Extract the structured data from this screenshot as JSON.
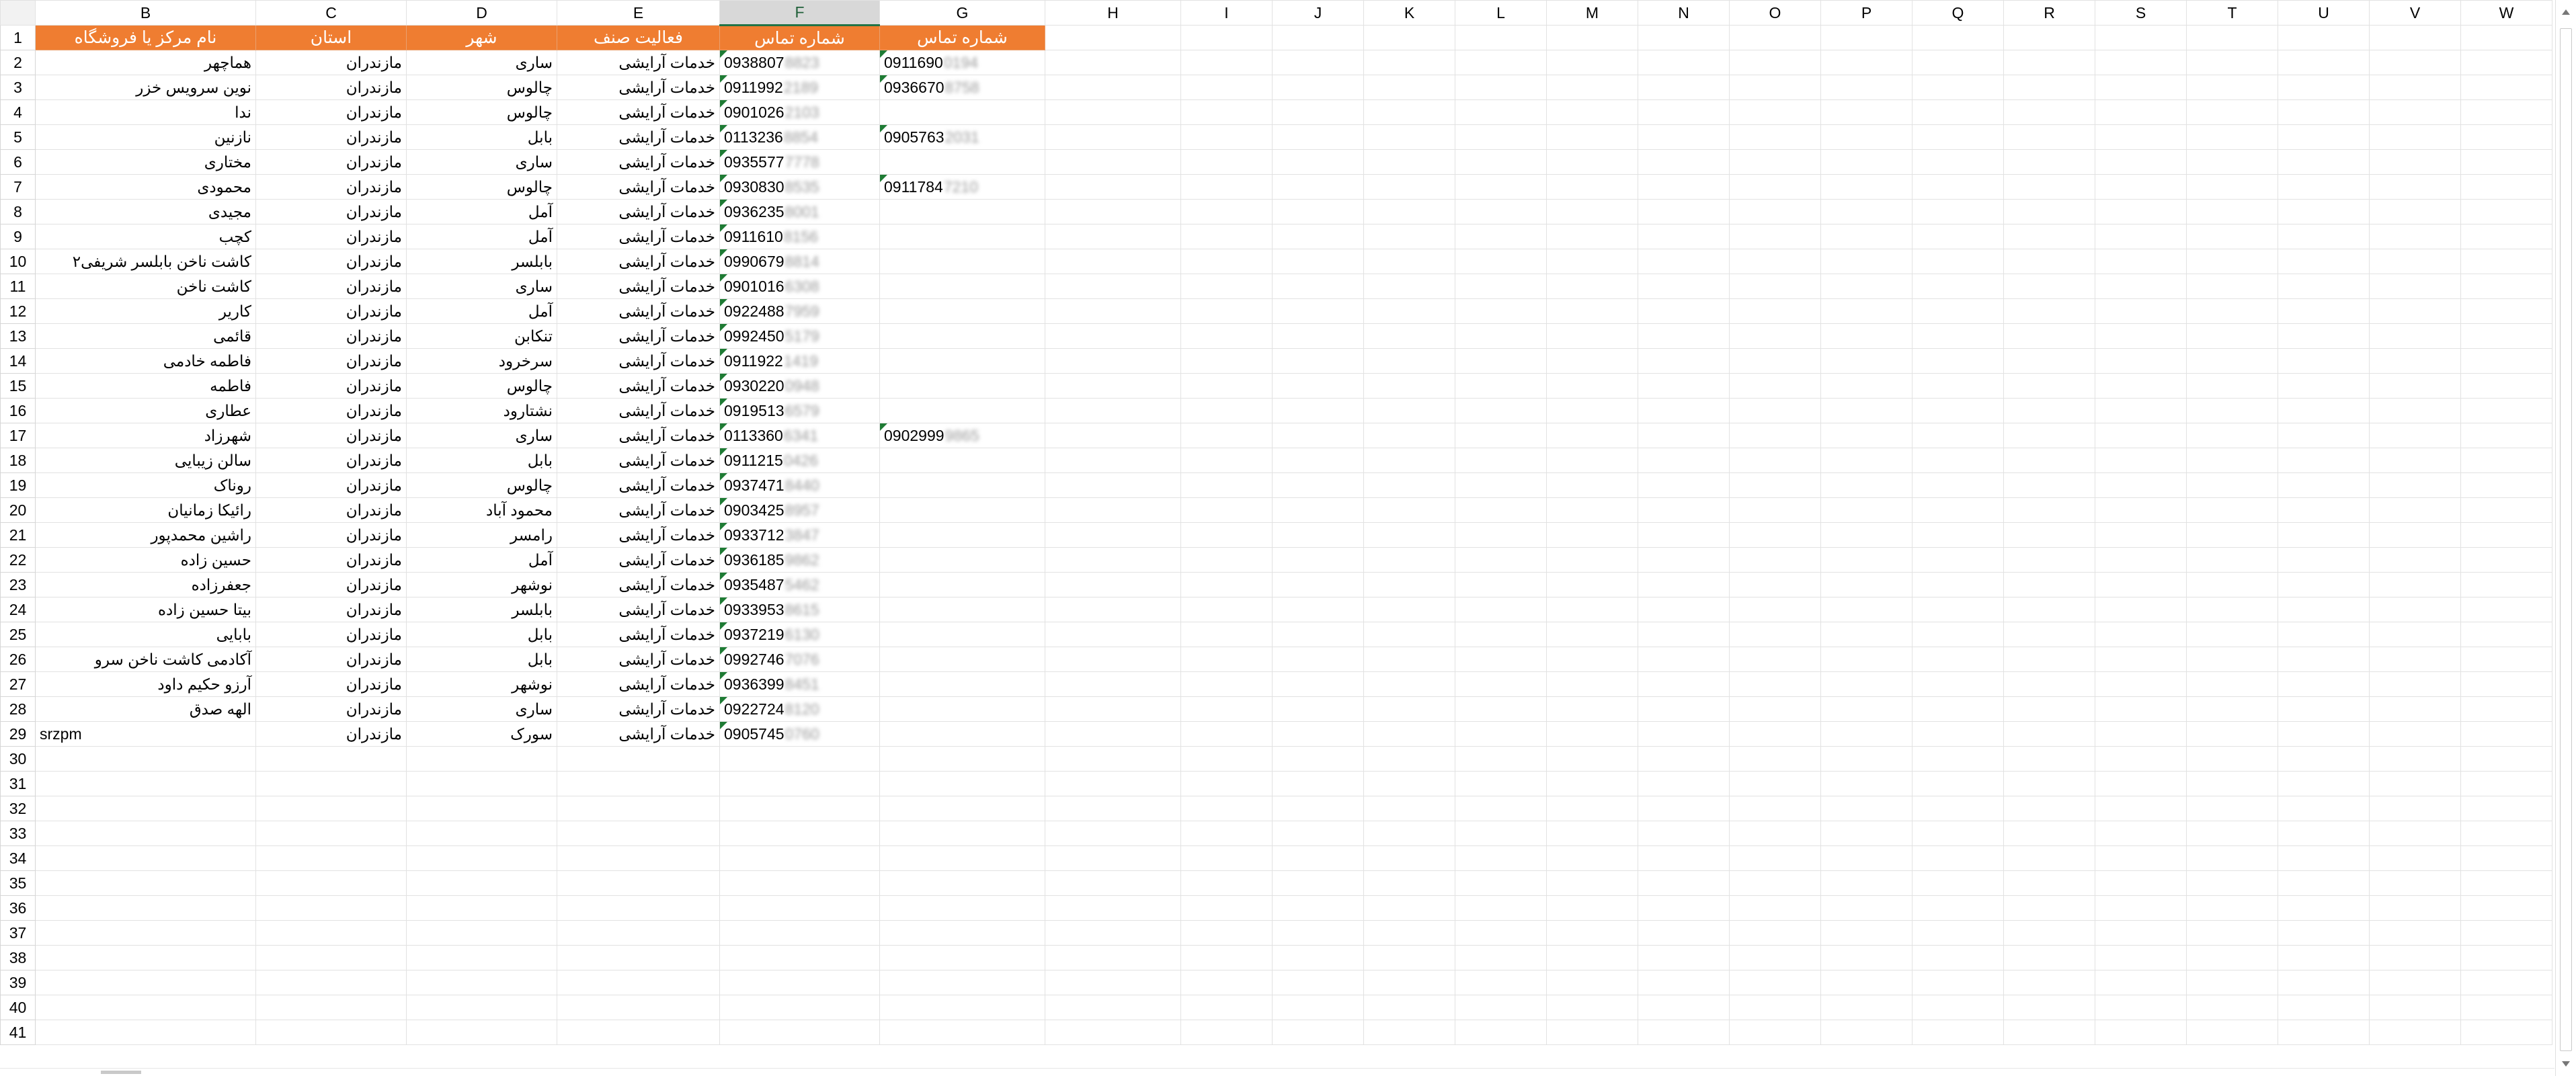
{
  "columns": [
    "B",
    "C",
    "D",
    "E",
    "F",
    "G",
    "H",
    "I",
    "J",
    "K",
    "L",
    "M",
    "N",
    "O",
    "P",
    "Q",
    "R",
    "S",
    "T",
    "U",
    "V",
    "W"
  ],
  "selected_column": "F",
  "header_row": {
    "B": "نام مرکز یا فروشگاه",
    "C": "استان",
    "D": "شهر",
    "E": "فعالیت صنف",
    "F": "شماره تماس",
    "G": "شماره تماس"
  },
  "rows": [
    {
      "n": "2",
      "name": "هماچهر",
      "province": "مازندران",
      "city": "ساری",
      "activity": "خدمات آرایشی",
      "phone1": "0938807",
      "phone1_hidden": "8823",
      "phone2": "0911690",
      "phone2_hidden": "0194"
    },
    {
      "n": "3",
      "name": "نوین سرویس خزر",
      "province": "مازندران",
      "city": "چالوس",
      "activity": "خدمات آرایشی",
      "phone1": "0911992",
      "phone1_hidden": "2189",
      "phone2": "0936670",
      "phone2_hidden": "8758"
    },
    {
      "n": "4",
      "name": "ندا",
      "province": "مازندران",
      "city": "چالوس",
      "activity": "خدمات آرایشی",
      "phone1": "0901026",
      "phone1_hidden": "2103",
      "phone2": "",
      "phone2_hidden": ""
    },
    {
      "n": "5",
      "name": "نازنین",
      "province": "مازندران",
      "city": "بابل",
      "activity": "خدمات آرایشی",
      "phone1": "0113236",
      "phone1_hidden": "8854",
      "phone2": "0905763",
      "phone2_hidden": "2031"
    },
    {
      "n": "6",
      "name": "مختاری",
      "province": "مازندران",
      "city": "ساری",
      "activity": "خدمات آرایشی",
      "phone1": "0935577",
      "phone1_hidden": "7778",
      "phone2": "",
      "phone2_hidden": ""
    },
    {
      "n": "7",
      "name": "محمودی",
      "province": "مازندران",
      "city": "چالوس",
      "activity": "خدمات آرایشی",
      "phone1": "0930830",
      "phone1_hidden": "8535",
      "phone2": "0911784",
      "phone2_hidden": "7210"
    },
    {
      "n": "8",
      "name": "مجیدی",
      "province": "مازندران",
      "city": "آمل",
      "activity": "خدمات آرایشی",
      "phone1": "0936235",
      "phone1_hidden": "8001",
      "phone2": "",
      "phone2_hidden": ""
    },
    {
      "n": "9",
      "name": "کچب",
      "province": "مازندران",
      "city": "آمل",
      "activity": "خدمات آرایشی",
      "phone1": "0911610",
      "phone1_hidden": "8156",
      "phone2": "",
      "phone2_hidden": ""
    },
    {
      "n": "10",
      "name": "کاشت ناخن بابلسر شریفی۲",
      "province": "مازندران",
      "city": "بابلسر",
      "activity": "خدمات آرایشی",
      "phone1": "0990679",
      "phone1_hidden": "8814",
      "phone2": "",
      "phone2_hidden": ""
    },
    {
      "n": "11",
      "name": "کاشت ناخن",
      "province": "مازندران",
      "city": "ساری",
      "activity": "خدمات آرایشی",
      "phone1": "0901016",
      "phone1_hidden": "6308",
      "phone2": "",
      "phone2_hidden": ""
    },
    {
      "n": "12",
      "name": "کاریر",
      "province": "مازندران",
      "city": "آمل",
      "activity": "خدمات آرایشی",
      "phone1": "0922488",
      "phone1_hidden": "7959",
      "phone2": "",
      "phone2_hidden": ""
    },
    {
      "n": "13",
      "name": "قائمی",
      "province": "مازندران",
      "city": "تنکابن",
      "activity": "خدمات آرایشی",
      "phone1": "0992450",
      "phone1_hidden": "5179",
      "phone2": "",
      "phone2_hidden": ""
    },
    {
      "n": "14",
      "name": "فاطمه خادمی",
      "province": "مازندران",
      "city": "سرخرود",
      "activity": "خدمات آرایشی",
      "phone1": "0911922",
      "phone1_hidden": "1419",
      "phone2": "",
      "phone2_hidden": ""
    },
    {
      "n": "15",
      "name": "فاطمه",
      "province": "مازندران",
      "city": "چالوس",
      "activity": "خدمات آرایشی",
      "phone1": "0930220",
      "phone1_hidden": "0948",
      "phone2": "",
      "phone2_hidden": ""
    },
    {
      "n": "16",
      "name": "عطاری",
      "province": "مازندران",
      "city": "نشتارود",
      "activity": "خدمات آرایشی",
      "phone1": "0919513",
      "phone1_hidden": "6579",
      "phone2": "",
      "phone2_hidden": ""
    },
    {
      "n": "17",
      "name": "شهرزاد",
      "province": "مازندران",
      "city": "ساری",
      "activity": "خدمات آرایشی",
      "phone1": "0113360",
      "phone1_hidden": "6341",
      "phone2": "0902999",
      "phone2_hidden": "9865"
    },
    {
      "n": "18",
      "name": "سالن زیبایی",
      "province": "مازندران",
      "city": "بابل",
      "activity": "خدمات آرایشی",
      "phone1": "0911215",
      "phone1_hidden": "0426",
      "phone2": "",
      "phone2_hidden": ""
    },
    {
      "n": "19",
      "name": "روناک",
      "province": "مازندران",
      "city": "چالوس",
      "activity": "خدمات آرایشی",
      "phone1": "0937471",
      "phone1_hidden": "8440",
      "phone2": "",
      "phone2_hidden": ""
    },
    {
      "n": "20",
      "name": "رائیکا زمانیان",
      "province": "مازندران",
      "city": "محمود آباد",
      "activity": "خدمات آرایشی",
      "phone1": "0903425",
      "phone1_hidden": "8957",
      "phone2": "",
      "phone2_hidden": ""
    },
    {
      "n": "21",
      "name": "راشین محمدپور",
      "province": "مازندران",
      "city": "رامسر",
      "activity": "خدمات آرایشی",
      "phone1": "0933712",
      "phone1_hidden": "3847",
      "phone2": "",
      "phone2_hidden": ""
    },
    {
      "n": "22",
      "name": "حسین زاده",
      "province": "مازندران",
      "city": "آمل",
      "activity": "خدمات آرایشی",
      "phone1": "0936185",
      "phone1_hidden": "9862",
      "phone2": "",
      "phone2_hidden": ""
    },
    {
      "n": "23",
      "name": "جعفرزاده",
      "province": "مازندران",
      "city": "نوشهر",
      "activity": "خدمات آرایشی",
      "phone1": "0935487",
      "phone1_hidden": "5462",
      "phone2": "",
      "phone2_hidden": ""
    },
    {
      "n": "24",
      "name": "بیتا حسین زاده",
      "province": "مازندران",
      "city": "بابلسر",
      "activity": "خدمات آرایشی",
      "phone1": "0933953",
      "phone1_hidden": "8615",
      "phone2": "",
      "phone2_hidden": ""
    },
    {
      "n": "25",
      "name": "بابایی",
      "province": "مازندران",
      "city": "بابل",
      "activity": "خدمات آرایشی",
      "phone1": "0937219",
      "phone1_hidden": "6130",
      "phone2": "",
      "phone2_hidden": ""
    },
    {
      "n": "26",
      "name": "آکادمی کاشت ناخن سرو",
      "province": "مازندران",
      "city": "بابل",
      "activity": "خدمات آرایشی",
      "phone1": "0992746",
      "phone1_hidden": "7076",
      "phone2": "",
      "phone2_hidden": ""
    },
    {
      "n": "27",
      "name": "آرزو حکیم داود",
      "province": "مازندران",
      "city": "نوشهر",
      "activity": "خدمات آرایشی",
      "phone1": "0936399",
      "phone1_hidden": "8451",
      "phone2": "",
      "phone2_hidden": ""
    },
    {
      "n": "28",
      "name": "الهه صدق",
      "province": "مازندران",
      "city": "ساری",
      "activity": "خدمات آرایشی",
      "phone1": "0922724",
      "phone1_hidden": "8120",
      "phone2": "",
      "phone2_hidden": ""
    },
    {
      "n": "29",
      "name": "srzpm",
      "province": "مازندران",
      "city": "سورک",
      "activity": "خدمات آرایشی",
      "phone1": "0905745",
      "phone1_hidden": "0760",
      "phone2": "",
      "phone2_hidden": ""
    }
  ],
  "empty_rows": [
    "30",
    "31",
    "32",
    "33",
    "34",
    "35",
    "36",
    "37",
    "38",
    "39",
    "40",
    "41"
  ],
  "colors": {
    "header_fill": "#ef7d31",
    "header_text": "#ffffff",
    "error_indicator": "#1e7b34",
    "selection": "#217346"
  }
}
